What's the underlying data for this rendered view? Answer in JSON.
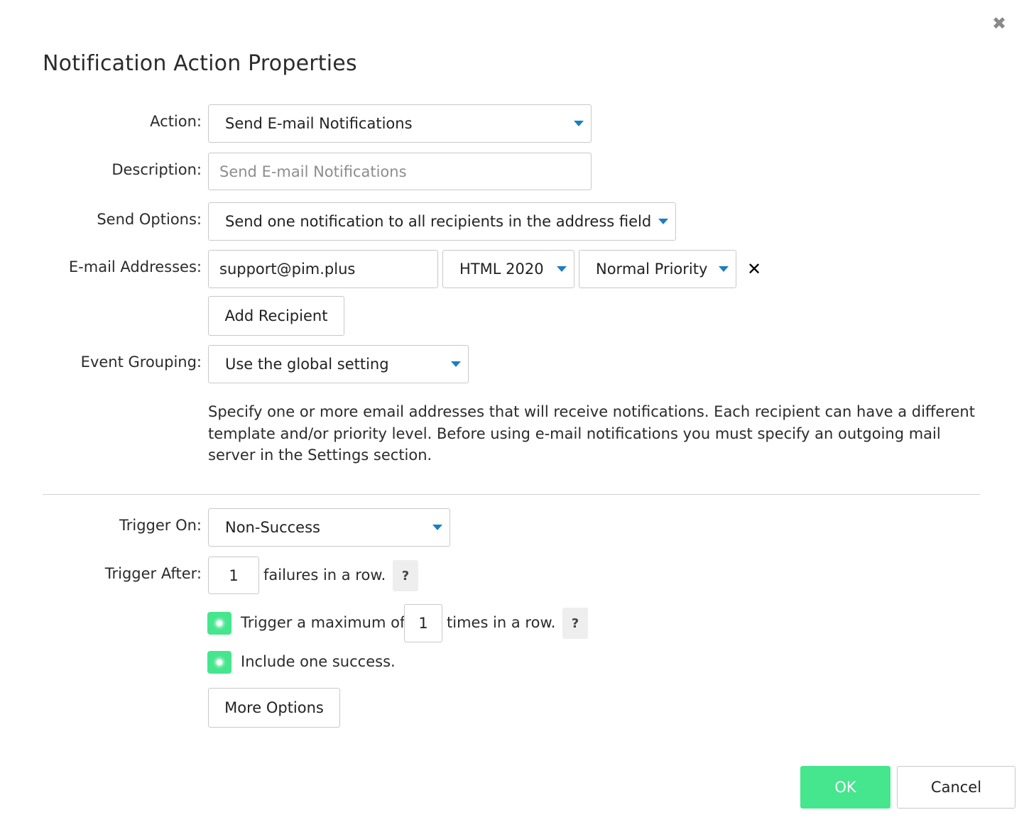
{
  "dialog": {
    "title": "Notification Action Properties",
    "close_icon": "close-icon"
  },
  "form": {
    "action": {
      "label": "Action:",
      "value": "Send E-mail Notifications"
    },
    "description": {
      "label": "Description:",
      "placeholder": "Send E-mail Notifications",
      "value": ""
    },
    "send_options": {
      "label": "Send Options:",
      "value": "Send one notification to all recipients in the address field"
    },
    "email": {
      "label": "E-mail Addresses:",
      "address": "support@pim.plus",
      "template": "HTML 2020",
      "priority": "Normal Priority",
      "remove_icon": "remove-icon"
    },
    "add_recipient": "Add Recipient",
    "event_grouping": {
      "label": "Event Grouping:",
      "value": "Use the global setting"
    },
    "help_text": "Specify one or more email addresses that will receive notifications. Each recipient can have a different template and/or priority level. Before using e-mail notifications you must specify an outgoing mail server in the Settings section.",
    "trigger_on": {
      "label": "Trigger On:",
      "value": "Non-Success"
    },
    "trigger_after": {
      "label": "Trigger After:",
      "value": "1",
      "suffix": "failures in a row.",
      "help": "?"
    },
    "trigger_max": {
      "enabled": true,
      "prefix": "Trigger a maximum of",
      "value": "1",
      "suffix": "times in a row.",
      "help": "?"
    },
    "include_success": {
      "enabled": true,
      "label": "Include one success."
    },
    "more_options": "More Options"
  },
  "footer": {
    "ok": "OK",
    "cancel": "Cancel"
  },
  "colors": {
    "accent_green": "#45e68d",
    "caret_blue": "#1a7fc1",
    "border": "#c9c9c9"
  }
}
